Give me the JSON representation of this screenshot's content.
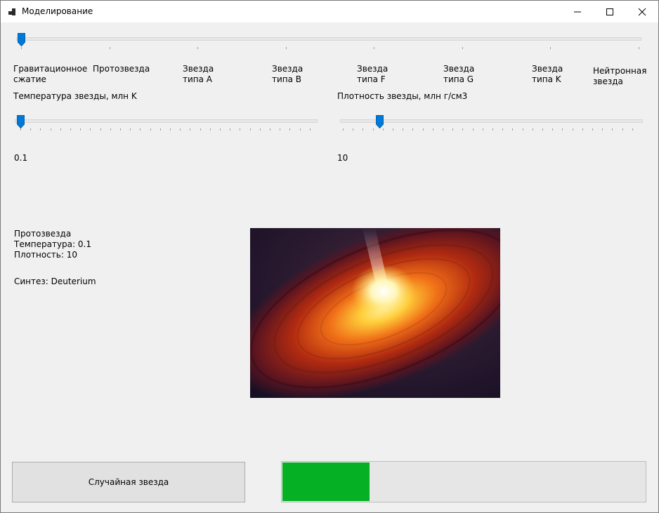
{
  "window": {
    "title": "Моделирование"
  },
  "stage_slider": {
    "value_index": 0,
    "stages": [
      "Гравитационное\nсжатие",
      "Протозвезда",
      "Звезда\nтипа A",
      "Звезда\nтипа B",
      "Звезда\nтипа F",
      "Звезда\nтипа G",
      "Звезда\nтипа K",
      "Нейтронная\nзвезда"
    ]
  },
  "temperature": {
    "label": "Температура звезды, млн K",
    "value": "0.1"
  },
  "density": {
    "label": "Плотность звезды, млн г/см3",
    "value": "10"
  },
  "info": {
    "stage": "Протозвезда",
    "temperature_line": "Температура: 0.1",
    "density_line": "Плотность: 10",
    "synthesis_line": "Синтез: Deuterium"
  },
  "random_button": {
    "label": "Случайная звезда"
  },
  "progress": {
    "fraction": 0.24,
    "color": "#06b025"
  },
  "colors": {
    "accent": "#0078d7"
  }
}
